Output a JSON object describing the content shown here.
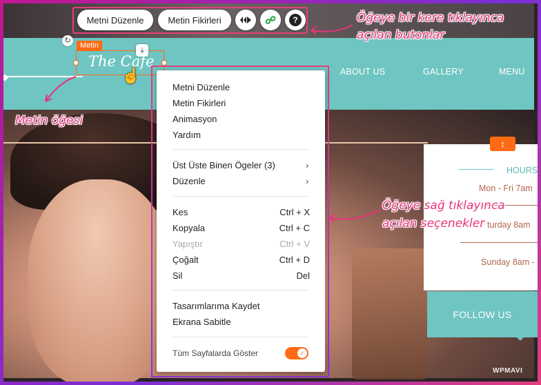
{
  "toolbar": {
    "edit_text_label": "Metni Düzenle",
    "text_ideas_label": "Metin Fikirleri"
  },
  "element": {
    "tag_label": "Metin",
    "logo_text": "The Cafe"
  },
  "site_nav": {
    "items": [
      "ABOUT US",
      "GALLERY",
      "MENU"
    ]
  },
  "info_panel": {
    "title": "HOURS",
    "lines": [
      "Mon - Fri 7am",
      "turday 8am",
      "Sunday 8am -"
    ],
    "follow_label": "FOLLOW US"
  },
  "context_menu": {
    "groups": [
      [
        {
          "label": "Metni Düzenle"
        },
        {
          "label": "Metin Fikirleri"
        },
        {
          "label": "Animasyon"
        },
        {
          "label": "Yardım"
        }
      ],
      [
        {
          "label": "Üst Üste Binen Ögeler (3)",
          "submenu": true
        },
        {
          "label": "Düzenle",
          "submenu": true
        }
      ],
      [
        {
          "label": "Kes",
          "shortcut": "Ctrl + X"
        },
        {
          "label": "Kopyala",
          "shortcut": "Ctrl + C"
        },
        {
          "label": "Yapıştır",
          "shortcut": "Ctrl + V",
          "disabled": true
        },
        {
          "label": "Çoğalt",
          "shortcut": "Ctrl + D"
        },
        {
          "label": "Sil",
          "shortcut": "Del"
        }
      ],
      [
        {
          "label": "Tasarımlarıma Kaydet"
        },
        {
          "label": "Ekrana Sabitle"
        }
      ]
    ],
    "toggle_label": "Tüm Sayfalarda Göster",
    "toggle_on": true
  },
  "annotations": {
    "toolbar_note_line1": "Öğeye bir kere tıklayınca",
    "toolbar_note_line2": "açılan butonlar",
    "element_note": "Metin öğesi",
    "menu_note_line1": "Öğeye sağ tıklayınca",
    "menu_note_line2": "açılan seçenekler"
  },
  "watermark": "WPMAVI",
  "colors": {
    "accent_orange": "#ff6a13",
    "annotation_pink": "#e8327a",
    "site_teal": "#6fc5c1"
  },
  "icons": [
    "animation-icon",
    "link-icon",
    "help-icon",
    "rotate-icon",
    "download-icon",
    "hand-cursor-icon",
    "chevron-right-icon",
    "up-down-icon"
  ]
}
